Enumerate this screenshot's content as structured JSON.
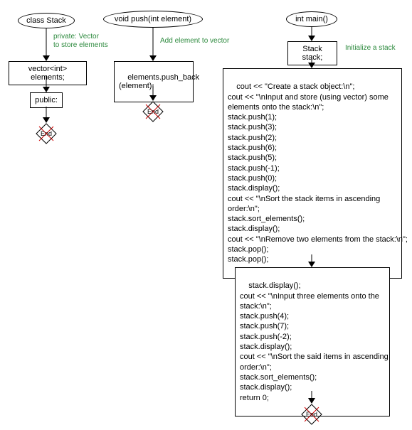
{
  "col1": {
    "start": "class Stack",
    "ann1": "private: Vector\nto store elements",
    "box1": "vector<int> elements;",
    "box2": "public:",
    "end": "End"
  },
  "col2": {
    "start": "void push(int element)",
    "ann1": "Add element to vector",
    "box1": "elements.push_back\n(element);",
    "end": "End"
  },
  "col3": {
    "start": "int main()",
    "box1": "Stack stack;",
    "ann1": "Initialize a stack",
    "box2": "cout << \"Create a stack object:\\n\";\ncout << \"\\nInput and store (using vector) some\nelements onto the stack:\\n\";\nstack.push(1);\nstack.push(3);\nstack.push(2);\nstack.push(6);\nstack.push(5);\nstack.push(-1);\nstack.push(0);\nstack.display();\ncout << \"\\nSort the stack items in ascending\norder:\\n\";\nstack.sort_elements();\nstack.display();\ncout << \"\\nRemove two elements from the stack:\\n\";\nstack.pop();\nstack.pop();",
    "box3": "stack.display();\ncout << \"\\nInput three elements onto the\nstack:\\n\";\nstack.push(4);\nstack.push(7);\nstack.push(-2);\nstack.display();\ncout << \"\\nSort the said items in ascending\norder:\\n\";\nstack.sort_elements();\nstack.display();\nreturn 0;",
    "end": "End"
  }
}
